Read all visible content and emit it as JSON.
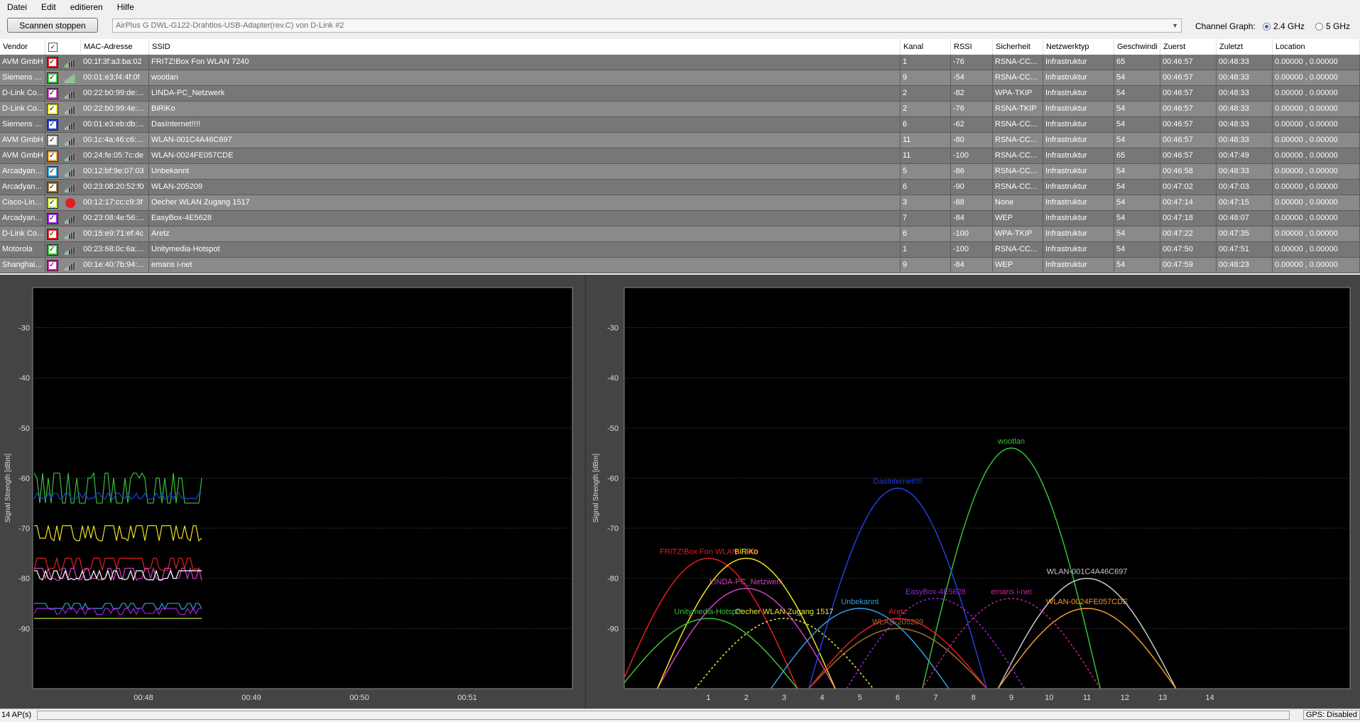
{
  "menu": [
    "Datei",
    "Edit",
    "editieren",
    "Hilfe"
  ],
  "toolbar": {
    "scan_button": "Scannen stoppen",
    "adapter": "AirPlus G DWL-G122-Drahtlos-USB-Adapter(rev.C) von D-Link #2",
    "channel_graph_label": "Channel Graph:",
    "band_24": "2.4 GHz",
    "band_5": "5 GHz",
    "selected_band": "2.4 GHz"
  },
  "table": {
    "headers": [
      "Vendor",
      "",
      "MAC-Adresse",
      "SSID",
      "Kanal",
      "RSSI",
      "Sicherheit",
      "Netzwerktyp",
      "Geschwindi",
      "Zuerst",
      "Zuletzt",
      "Location"
    ],
    "rows": [
      {
        "vendor": "AVM GmbH",
        "color": "#e02020",
        "mac": "00:1f:3f:a3:ba:02",
        "ssid": "FRITZ!Box Fon WLAN 7240",
        "kanal": "1",
        "rssi": "-76",
        "sec": "RSNA-CC...",
        "type": "Infrastruktur",
        "speed": "65",
        "first": "00:46:57",
        "last": "00:48:33",
        "loc": "0.00000 , 0.00000",
        "signal": "bars"
      },
      {
        "vendor": "Siemens ...",
        "color": "#38c038",
        "mac": "00:01:e3:f4:4f:0f",
        "ssid": "wootlan",
        "kanal": "9",
        "rssi": "-54",
        "sec": "RSNA-CC...",
        "type": "Infrastruktur",
        "speed": "54",
        "first": "00:46:57",
        "last": "00:48:33",
        "loc": "0.00000 , 0.00000",
        "signal": "bars-green"
      },
      {
        "vendor": "D-Link Co...",
        "color": "#d040c0",
        "mac": "00:22:b0:99:de:...",
        "ssid": "LINDA-PC_Netzwerk",
        "kanal": "2",
        "rssi": "-82",
        "sec": "WPA-TKIP",
        "type": "Infrastruktur",
        "speed": "54",
        "first": "00:46:57",
        "last": "00:48:33",
        "loc": "0.00000 , 0.00000",
        "signal": "bars"
      },
      {
        "vendor": "D-Link Co...",
        "color": "#f0e020",
        "mac": "00:22:b0:99:4e:...",
        "ssid": "BiRiKo",
        "kanal": "2",
        "rssi": "-76",
        "sec": "RSNA-TKIP",
        "type": "Infrastruktur",
        "speed": "54",
        "first": "00:46:57",
        "last": "00:48:33",
        "loc": "0.00000 , 0.00000",
        "signal": "bars"
      },
      {
        "vendor": "Siemens ...",
        "color": "#2040e0",
        "mac": "00:01:e3:eb:db:...",
        "ssid": "DasInternet!!!!",
        "kanal": "6",
        "rssi": "-62",
        "sec": "RSNA-CC...",
        "type": "Infrastruktur",
        "speed": "54",
        "first": "00:46:57",
        "last": "00:48:33",
        "loc": "0.00000 , 0.00000",
        "signal": "bars"
      },
      {
        "vendor": "AVM GmbH",
        "color": "#c8c8c8",
        "mac": "00:1c:4a:46:c6:...",
        "ssid": "WLAN-001C4A46C697",
        "kanal": "11",
        "rssi": "-80",
        "sec": "RSNA-CC...",
        "type": "Infrastruktur",
        "speed": "54",
        "first": "00:46:57",
        "last": "00:48:33",
        "loc": "0.00000 , 0.00000",
        "signal": "bars"
      },
      {
        "vendor": "AVM GmbH",
        "color": "#f09a30",
        "mac": "00:24:fe:05:7c:de",
        "ssid": "WLAN-0024FE057CDE",
        "kanal": "11",
        "rssi": "-100",
        "sec": "RSNA-CC...",
        "type": "Infrastruktur",
        "speed": "65",
        "first": "00:46:57",
        "last": "00:47:49",
        "loc": "0.00000 , 0.00000",
        "signal": "bars"
      },
      {
        "vendor": "Arcadyan...",
        "color": "#30a0e0",
        "mac": "00:12:bf:9e:07:03",
        "ssid": "Unbekannt",
        "kanal": "5",
        "rssi": "-86",
        "sec": "RSNA-CC...",
        "type": "Infrastruktur",
        "speed": "54",
        "first": "00:46:58",
        "last": "00:48:33",
        "loc": "0.00000 , 0.00000",
        "signal": "bars"
      },
      {
        "vendor": "Arcadyan...",
        "color": "#a07028",
        "mac": "00:23:08:20:52:f0",
        "ssid": "WLAN-205209",
        "kanal": "6",
        "rssi": "-90",
        "sec": "RSNA-CC...",
        "type": "Infrastruktur",
        "speed": "54",
        "first": "00:47:02",
        "last": "00:47:03",
        "loc": "0.00000 , 0.00000",
        "signal": "bars"
      },
      {
        "vendor": "Cisco-Lin...",
        "color": "#c0e040",
        "mac": "00:12:17:cc:c9:3f",
        "ssid": "Oecher WLAN Zugang 1517",
        "kanal": "3",
        "rssi": "-88",
        "sec": "None",
        "type": "Infrastruktur",
        "speed": "54",
        "first": "00:47:14",
        "last": "00:47:15",
        "loc": "0.00000 , 0.00000",
        "signal": "open"
      },
      {
        "vendor": "Arcadyan...",
        "color": "#a020e0",
        "mac": "00:23:08:4e:56:...",
        "ssid": "EasyBox-4E5628",
        "kanal": "7",
        "rssi": "-84",
        "sec": "WEP",
        "type": "Infrastruktur",
        "speed": "54",
        "first": "00:47:18",
        "last": "00:48:07",
        "loc": "0.00000 , 0.00000",
        "signal": "bars"
      },
      {
        "vendor": "D-Link Co...",
        "color": "#e02020",
        "mac": "00:15:e9:71:ef:4c",
        "ssid": "Aretz",
        "kanal": "6",
        "rssi": "-100",
        "sec": "WPA-TKIP",
        "type": "Infrastruktur",
        "speed": "54",
        "first": "00:47:22",
        "last": "00:47:35",
        "loc": "0.00000 , 0.00000",
        "signal": "bars"
      },
      {
        "vendor": "Motorola",
        "color": "#38c038",
        "mac": "00:23:68:0c:6a:...",
        "ssid": "Unitymedia-Hotspot",
        "kanal": "1",
        "rssi": "-100",
        "sec": "RSNA-CC...",
        "type": "Infrastruktur",
        "speed": "54",
        "first": "00:47:50",
        "last": "00:47:51",
        "loc": "0.00000 , 0.00000",
        "signal": "bars"
      },
      {
        "vendor": "Shanghai...",
        "color": "#d020a0",
        "mac": "00:1e:40:7b:94:...",
        "ssid": "emans i-net",
        "kanal": "9",
        "rssi": "-84",
        "sec": "WEP",
        "type": "Infrastruktur",
        "speed": "54",
        "first": "00:47:59",
        "last": "00:48:23",
        "loc": "0.00000 , 0.00000",
        "signal": "bars"
      }
    ]
  },
  "time_graph": {
    "ylabel": "Signal Strength [dBm]",
    "yticks": [
      "-30",
      "-40",
      "-50",
      "-60",
      "-70",
      "-80",
      "-90"
    ],
    "xticks": [
      "00:48",
      "00:49",
      "00:50",
      "00:51"
    ]
  },
  "chart_data": {
    "type": "line",
    "title": "",
    "xlabel": "",
    "ylabel": "Signal Strength [dBm]",
    "xticks": [
      "1",
      "2",
      "3",
      "4",
      "5",
      "6",
      "7",
      "8",
      "9",
      "10",
      "11",
      "12",
      "13",
      "14"
    ],
    "yticks": [
      "-30",
      "-40",
      "-50",
      "-60",
      "-70",
      "-80",
      "-90"
    ],
    "ylim": [
      -102,
      -22
    ],
    "series": [
      {
        "name": "FRITZ!Box Fon WLAN 7240",
        "channel": 1,
        "rssi": -76,
        "color": "#e02020",
        "dashed": false
      },
      {
        "name": "wootlan",
        "channel": 9,
        "rssi": -54,
        "color": "#38c038",
        "dashed": false
      },
      {
        "name": "LINDA-PC_Netzwerk",
        "channel": 2,
        "rssi": -82,
        "color": "#d040c0",
        "dashed": false
      },
      {
        "name": "BiRiKo",
        "channel": 2,
        "rssi": -76,
        "color": "#f0e020",
        "dashed": false
      },
      {
        "name": "DasInternet!!!!",
        "channel": 6,
        "rssi": -62,
        "color": "#2040e0",
        "dashed": false
      },
      {
        "name": "WLAN-001C4A46C697",
        "channel": 11,
        "rssi": -80,
        "color": "#c8c8c8",
        "dashed": false
      },
      {
        "name": "WLAN-0024FE057CDE",
        "channel": 11,
        "rssi": -86,
        "color": "#f09a30",
        "dashed": false
      },
      {
        "name": "Unbekannt",
        "channel": 5,
        "rssi": -86,
        "color": "#30a0e0",
        "dashed": false
      },
      {
        "name": "WLAN-205209",
        "channel": 6,
        "rssi": -90,
        "color": "#a07028",
        "dashed": false
      },
      {
        "name": "Oecher WLAN Zugang 1517",
        "channel": 3,
        "rssi": -88,
        "color": "#e8e840",
        "dashed": true
      },
      {
        "name": "EasyBox-4E5628",
        "channel": 7,
        "rssi": -84,
        "color": "#a020e0",
        "dashed": true
      },
      {
        "name": "Aretz",
        "channel": 6,
        "rssi": -88,
        "color": "#e02020",
        "dashed": false
      },
      {
        "name": "Unitymedia-Hotspot",
        "channel": 1,
        "rssi": -88,
        "color": "#38c038",
        "dashed": false
      },
      {
        "name": "emans i-net",
        "channel": 9,
        "rssi": -84,
        "color": "#d020a0",
        "dashed": true
      }
    ]
  },
  "status": {
    "ap_count": "14 AP(s)",
    "gps": "GPS: Disabled"
  },
  "icons": {
    "checkbox": "checkbox-icon",
    "signal": "signal-bars-icon",
    "open": "open-network-icon"
  }
}
